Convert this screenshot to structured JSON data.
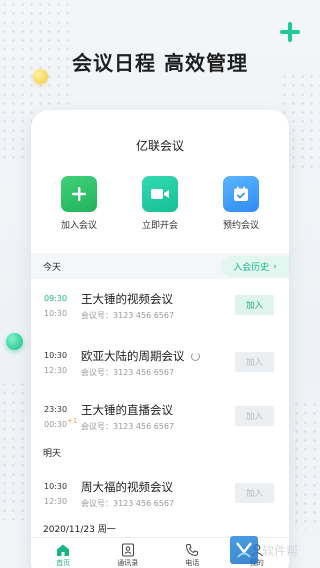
{
  "headline": "会议日程 高效管理",
  "app": {
    "title": "亿联会议"
  },
  "actions": [
    {
      "label": "加入会议",
      "icon": "plus-icon",
      "color": "#2bbf66"
    },
    {
      "label": "立即开会",
      "icon": "video-camera-icon",
      "color": "#1ec79c"
    },
    {
      "label": "预约会议",
      "icon": "calendar-check-icon",
      "color": "#3b96f7"
    }
  ],
  "today": {
    "title": "今天",
    "history_label": "入会历史"
  },
  "meetings_today": [
    {
      "start": "09:30",
      "end": "10:30",
      "name": "王大锤的视频会议",
      "number": "会议号：3123 456 6567",
      "join_label": "加入",
      "join_state": "active"
    },
    {
      "start": "10:30",
      "end": "12:30",
      "name": "欧亚大陆的周期会议",
      "number": "会议号：3123 456 6567",
      "join_label": "加入",
      "join_state": "disabled"
    },
    {
      "start": "23:30",
      "end": "00:30",
      "extra": "+1",
      "name": "王大锤的直播会议",
      "number": "会议号：3123 456 6567",
      "join_label": "加入",
      "join_state": "disabled"
    }
  ],
  "tomorrow": {
    "title": "明天"
  },
  "meetings_tomorrow": [
    {
      "start": "10:30",
      "end": "12:30",
      "name": "周大福的视频会议",
      "number": "会议号：3123 456 6567",
      "join_label": "加入",
      "join_state": "disabled"
    }
  ],
  "next_date": "2020/11/23 周一",
  "tabs": [
    {
      "label": "首页",
      "icon": "home-icon",
      "active": true
    },
    {
      "label": "通讯录",
      "icon": "contacts-icon",
      "active": false
    },
    {
      "label": "电话",
      "icon": "phone-icon",
      "active": false
    },
    {
      "label": "我的",
      "icon": "profile-icon",
      "active": false
    }
  ],
  "watermark": "软件帮",
  "accent": "#17b486"
}
